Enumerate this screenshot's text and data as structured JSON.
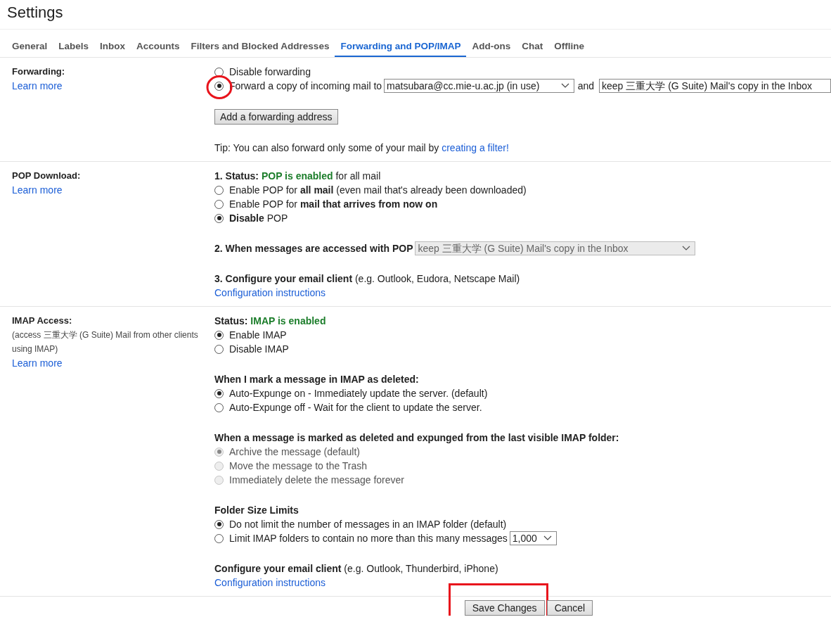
{
  "title": "Settings",
  "tabs": [
    {
      "label": "General",
      "selected": false
    },
    {
      "label": "Labels",
      "selected": false
    },
    {
      "label": "Inbox",
      "selected": false
    },
    {
      "label": "Accounts",
      "selected": false
    },
    {
      "label": "Filters and Blocked Addresses",
      "selected": false
    },
    {
      "label": "Forwarding and POP/IMAP",
      "selected": true
    },
    {
      "label": "Add-ons",
      "selected": false
    },
    {
      "label": "Chat",
      "selected": false
    },
    {
      "label": "Offline",
      "selected": false
    }
  ],
  "sections": [
    {
      "label": "Forwarding:",
      "learn_more": "Learn more",
      "groups": [
        [
          {
            "kind": "radio",
            "text": "Disable forwarding",
            "selected": false,
            "disabled": false
          },
          {
            "kind": "radio",
            "text": "Forward a copy of incoming mail to",
            "selected": true,
            "disabled": false,
            "circled": true,
            "select": {
              "value": "matsubara@cc.mie-u.ac.jp (in use)",
              "disabled": false
            },
            "joiner": "and",
            "select_2": {
              "value": "keep 三重大学 (G Suite) Mail's copy in the Inbox",
              "disabled": false
            }
          }
        ],
        [
          {
            "kind": "button",
            "text": "Add a forwarding address"
          }
        ],
        [
          {
            "kind": "tip",
            "text": "Tip: You can also forward only some of your mail by",
            "link": "creating a filter!"
          }
        ]
      ]
    },
    {
      "label": "POP Download:",
      "learn_more": "Learn more",
      "groups": [
        [
          {
            "kind": "status",
            "prefix": "1. Status:",
            "status": "POP is enabled",
            "suffix": "for all mail"
          },
          {
            "kind": "radio",
            "text": "Enable POP for **all mail** (even mail that's already been downloaded)",
            "selected": false,
            "disabled": false
          },
          {
            "kind": "radio",
            "text": "Enable POP for **mail that arrives from now on**",
            "selected": false,
            "disabled": false
          },
          {
            "kind": "radio",
            "text": "**Disable** POP",
            "selected": true,
            "disabled": false
          }
        ],
        [
          {
            "kind": "select_row",
            "text": "2. When messages are accessed with POP",
            "select": {
              "value": "keep 三重大学 (G Suite) Mail's copy in the Inbox",
              "disabled": true
            }
          }
        ],
        [
          {
            "kind": "para",
            "text": "**3. Configure your email client** (e.g. Outlook, Eudora, Netscape Mail)"
          },
          {
            "kind": "link",
            "text": "Configuration instructions"
          }
        ]
      ]
    },
    {
      "label": "IMAP Access:",
      "note": "(access 三重大学 (G Suite) Mail from other clients using IMAP)",
      "learn_more": "Learn more",
      "groups": [
        [
          {
            "kind": "status",
            "prefix": "Status:",
            "status": "IMAP is enabled"
          },
          {
            "kind": "radio",
            "text": "Enable IMAP",
            "selected": true,
            "disabled": false
          },
          {
            "kind": "radio",
            "text": "Disable IMAP",
            "selected": false,
            "disabled": false
          }
        ],
        [
          {
            "kind": "heading",
            "text": "When I mark a message in IMAP as deleted:"
          },
          {
            "kind": "radio",
            "text": "Auto-Expunge on - Immediately update the server. (default)",
            "selected": true,
            "disabled": false
          },
          {
            "kind": "radio",
            "text": "Auto-Expunge off - Wait for the client to update the server.",
            "selected": false,
            "disabled": false
          }
        ],
        [
          {
            "kind": "heading",
            "text": "When a message is marked as deleted and expunged from the last visible IMAP folder:"
          },
          {
            "kind": "radio",
            "text": "Archive the message (default)",
            "selected": true,
            "disabled": true
          },
          {
            "kind": "radio",
            "text": "Move the message to the Trash",
            "selected": false,
            "disabled": true
          },
          {
            "kind": "radio",
            "text": "Immediately delete the message forever",
            "selected": false,
            "disabled": true
          }
        ],
        [
          {
            "kind": "heading",
            "text": "Folder Size Limits"
          },
          {
            "kind": "radio",
            "text": "Do not limit the number of messages in an IMAP folder (default)",
            "selected": true,
            "disabled": false
          },
          {
            "kind": "radio",
            "text": "Limit IMAP folders to contain no more than this many messages",
            "selected": false,
            "disabled": false,
            "select": {
              "value": "1,000",
              "disabled": false
            }
          }
        ],
        [
          {
            "kind": "para",
            "text": "**Configure your email client** (e.g. Outlook, Thunderbird, iPhone)"
          },
          {
            "kind": "link",
            "text": "Configuration instructions"
          }
        ]
      ]
    }
  ],
  "footer": [
    {
      "label": "Save Changes",
      "boxed": true
    },
    {
      "label": "Cancel",
      "boxed": false
    }
  ]
}
